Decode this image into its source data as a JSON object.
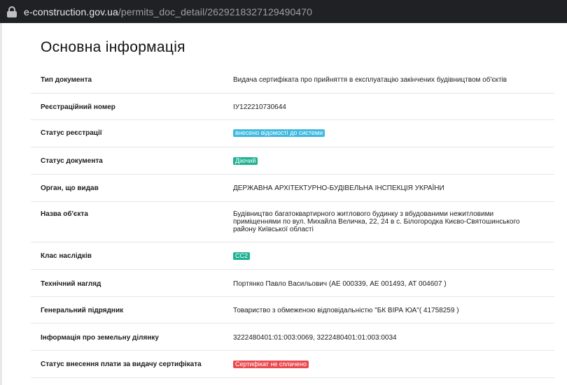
{
  "browser": {
    "url_host": "e-construction.gov.ua",
    "url_path": "/permits_doc_detail/2629218327129490470"
  },
  "section_title": "Основна інформація",
  "rows": [
    {
      "label": "Тип документа",
      "value": "Видача сертифіката про прийняття в експлуатацію закінчених будівництвом об'єктів"
    },
    {
      "label": "Реєстраційний номер",
      "value": "ІУ122210730644"
    },
    {
      "label": "Статус реєстрації",
      "value": "внесено відомості до системи"
    },
    {
      "label": "Статус документа",
      "value": "Діючий"
    },
    {
      "label": "Орган, що видав",
      "value": "ДЕРЖАВНА АРХІТЕКТУРНО-БУДІВЕЛЬНА ІНСПЕКЦІЯ УКРАЇНИ"
    },
    {
      "label": "Назва об'єкта",
      "value": "Будівництво багатоквартирного житлового будинку з вбудованими нежитловими приміщеннями по вул. Михайла Величка, 22, 24 в с. Білогородка Києво-Святошинського району Київської області"
    },
    {
      "label": "Клас наслідків",
      "value": "СС2"
    },
    {
      "label": "Технічний нагляд",
      "value": "Портянко Павло Васильович (АЕ 000339, АЕ 001493, АТ 004607 )"
    },
    {
      "label": "Генеральний підрядник",
      "value": "Товариство з обмеженою відповідальністю \"БК ВІРА ЮА\"( 41758259 )"
    },
    {
      "label": "Інформація про земельну ділянку",
      "value": "3222480401:01:003:0069, 3222480401:01:003:0034"
    },
    {
      "label": "Статус внесення плати за видачу сертифіката",
      "value": "Сертифікат не сплачено"
    }
  ],
  "colors": {
    "badge_info": "#3fb9df",
    "badge_active": "#1fb292",
    "badge_unpaid": "#ea4a4f"
  }
}
